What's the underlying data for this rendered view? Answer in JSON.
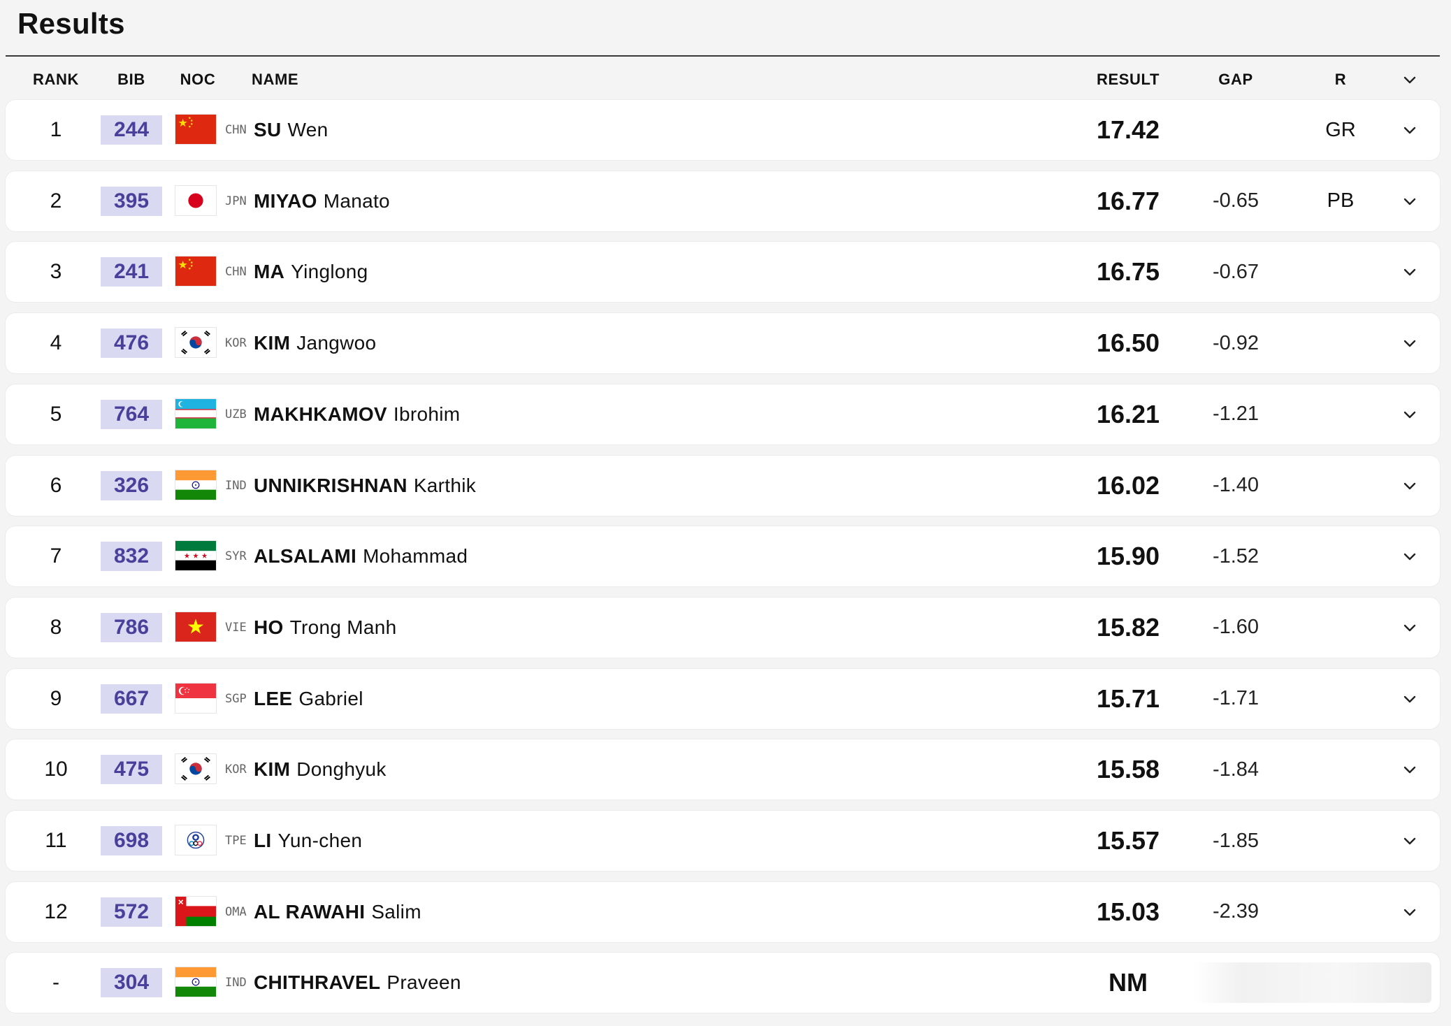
{
  "page_title": "Results",
  "columns": {
    "rank": "RANK",
    "bib": "BIB",
    "noc": "NOC",
    "name": "NAME",
    "result": "RESULT",
    "gap": "GAP",
    "record": "R"
  },
  "rows": [
    {
      "rank": "1",
      "bib": "244",
      "noc": "CHN",
      "family": "SU",
      "given": "Wen",
      "result": "17.42",
      "gap": "",
      "record": "GR",
      "flag": "chn-flag"
    },
    {
      "rank": "2",
      "bib": "395",
      "noc": "JPN",
      "family": "MIYAO",
      "given": "Manato",
      "result": "16.77",
      "gap": "-0.65",
      "record": "PB",
      "flag": "jpn-flag"
    },
    {
      "rank": "3",
      "bib": "241",
      "noc": "CHN",
      "family": "MA",
      "given": "Yinglong",
      "result": "16.75",
      "gap": "-0.67",
      "record": "",
      "flag": "chn-flag"
    },
    {
      "rank": "4",
      "bib": "476",
      "noc": "KOR",
      "family": "KIM",
      "given": "Jangwoo",
      "result": "16.50",
      "gap": "-0.92",
      "record": "",
      "flag": "kor-flag"
    },
    {
      "rank": "5",
      "bib": "764",
      "noc": "UZB",
      "family": "MAKHKAMOV",
      "given": "Ibrohim",
      "result": "16.21",
      "gap": "-1.21",
      "record": "",
      "flag": "uzb-flag"
    },
    {
      "rank": "6",
      "bib": "326",
      "noc": "IND",
      "family": "UNNIKRISHNAN",
      "given": "Karthik",
      "result": "16.02",
      "gap": "-1.40",
      "record": "",
      "flag": "ind-flag"
    },
    {
      "rank": "7",
      "bib": "832",
      "noc": "SYR",
      "family": "ALSALAMI",
      "given": "Mohammad",
      "result": "15.90",
      "gap": "-1.52",
      "record": "",
      "flag": "syr-flag"
    },
    {
      "rank": "8",
      "bib": "786",
      "noc": "VIE",
      "family": "HO",
      "given": "Trong Manh",
      "result": "15.82",
      "gap": "-1.60",
      "record": "",
      "flag": "vie-flag"
    },
    {
      "rank": "9",
      "bib": "667",
      "noc": "SGP",
      "family": "LEE",
      "given": "Gabriel",
      "result": "15.71",
      "gap": "-1.71",
      "record": "",
      "flag": "sgp-flag"
    },
    {
      "rank": "10",
      "bib": "475",
      "noc": "KOR",
      "family": "KIM",
      "given": "Donghyuk",
      "result": "15.58",
      "gap": "-1.84",
      "record": "",
      "flag": "kor-flag"
    },
    {
      "rank": "11",
      "bib": "698",
      "noc": "TPE",
      "family": "LI",
      "given": "Yun-chen",
      "result": "15.57",
      "gap": "-1.85",
      "record": "",
      "flag": "tpe-flag"
    },
    {
      "rank": "12",
      "bib": "572",
      "noc": "OMA",
      "family": "AL RAWAHI",
      "given": "Salim",
      "result": "15.03",
      "gap": "-2.39",
      "record": "",
      "flag": "oma-flag"
    },
    {
      "rank": "-",
      "bib": "304",
      "noc": "IND",
      "family": "CHITHRAVEL",
      "given": "Praveen",
      "result": "NM",
      "gap": "",
      "record": "",
      "flag": "ind-flag"
    }
  ],
  "colors": {
    "bib_bg": "#d9d9f2",
    "bib_text": "#4a3f9a",
    "row_bg": "#ffffff",
    "page_bg": "#f4f4f4"
  }
}
